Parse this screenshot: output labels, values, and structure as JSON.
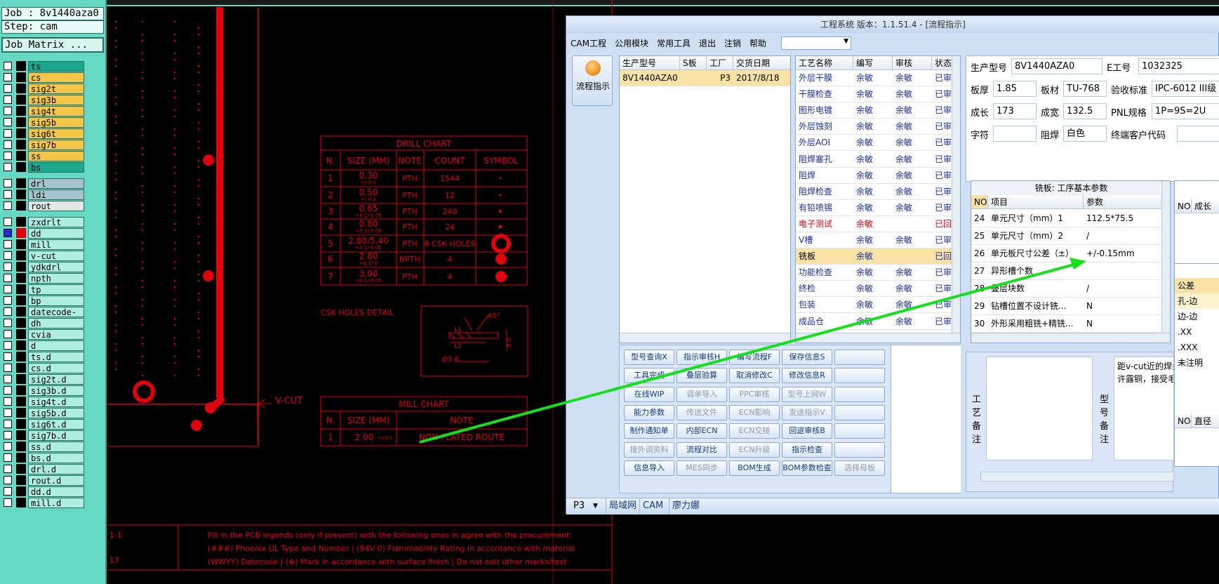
{
  "left_panel": {
    "job": "Job : 8v1440aza0",
    "step": "Step: cam",
    "matrix_button": "Job Matrix ...",
    "groups": [
      [
        {
          "name": "ts",
          "color": "#1aa88c"
        },
        {
          "name": "cs",
          "color": "#f5c648"
        },
        {
          "name": "sig2t",
          "color": "#f5c648"
        },
        {
          "name": "sig3b",
          "color": "#f5c648"
        },
        {
          "name": "sig4t",
          "color": "#f5c648"
        },
        {
          "name": "sig5b",
          "color": "#f5c648"
        },
        {
          "name": "sig6t",
          "color": "#f5c648"
        },
        {
          "name": "sig7b",
          "color": "#f5c648"
        },
        {
          "name": "ss",
          "color": "#f5c648"
        },
        {
          "name": "bs",
          "color": "#1aa88c"
        }
      ],
      [
        {
          "name": "drl",
          "color": "#a7c3cb"
        },
        {
          "name": "ldi",
          "color": "#a7c3cb"
        },
        {
          "name": "rout",
          "color": "#e3e8e2"
        }
      ],
      [
        {
          "name": "zxdrlt",
          "color": "#aeeee0"
        },
        {
          "name": "dd",
          "color": "#aeeee0",
          "active": true
        },
        {
          "name": "mill",
          "color": "#aeeee0"
        },
        {
          "name": "v-cut",
          "color": "#aeeee0"
        },
        {
          "name": "ydkdrl",
          "color": "#aeeee0"
        },
        {
          "name": "npth",
          "color": "#aeeee0"
        },
        {
          "name": "tp",
          "color": "#aeeee0"
        },
        {
          "name": "bp",
          "color": "#aeeee0"
        },
        {
          "name": "datecode-bs",
          "color": "#aeeee0"
        },
        {
          "name": "dh",
          "color": "#aeeee0"
        },
        {
          "name": "cvia",
          "color": "#aeeee0"
        },
        {
          "name": "d",
          "color": "#aeeee0"
        },
        {
          "name": "ts.d",
          "color": "#aeeee0"
        },
        {
          "name": "cs.d",
          "color": "#aeeee0"
        },
        {
          "name": "sig2t.d",
          "color": "#aeeee0"
        },
        {
          "name": "sig3b.d",
          "color": "#aeeee0"
        },
        {
          "name": "sig4t.d",
          "color": "#aeeee0"
        },
        {
          "name": "sig5b.d",
          "color": "#aeeee0"
        },
        {
          "name": "sig6t.d",
          "color": "#aeeee0"
        },
        {
          "name": "sig7b.d",
          "color": "#aeeee0"
        },
        {
          "name": "ss.d",
          "color": "#aeeee0"
        },
        {
          "name": "bs.d",
          "color": "#aeeee0"
        },
        {
          "name": "drl.d",
          "color": "#aeeee0"
        },
        {
          "name": "rout.d",
          "color": "#aeeee0"
        },
        {
          "name": "dd.d",
          "color": "#aeeee0"
        },
        {
          "name": "mill.d",
          "color": "#aeeee0"
        }
      ]
    ]
  },
  "cad": {
    "drill_title": "DRILL CHART",
    "drill_headers": [
      "N.",
      "SIZE (MM)",
      "NOTE",
      "COUNT",
      "SYMBOL"
    ],
    "drill_rows": [
      {
        "n": "1",
        "size": "0.30",
        "tol": "+/-0.1",
        "note": "PTH",
        "count": "1544"
      },
      {
        "n": "2",
        "size": "0.50",
        "tol": "+/-0.1",
        "note": "PTH",
        "count": "12"
      },
      {
        "n": "3",
        "size": "0.65",
        "tol": "+0.1/-0.05",
        "note": "PTH",
        "count": "240"
      },
      {
        "n": "4",
        "size": "0.80",
        "tol": "+0.1/-0.05",
        "note": "PTH",
        "count": "24"
      },
      {
        "n": "5",
        "size": "2.80/5.40",
        "tol": "+0.1/-0.05",
        "note": "PTH",
        "count": "8 CSK HOLES"
      },
      {
        "n": "6",
        "size": "2.80",
        "tol": "+0.1/-0",
        "note": "NPTH",
        "count": "4"
      },
      {
        "n": "7",
        "size": "3.00",
        "tol": "+0.1/-0.05",
        "note": "PTH",
        "count": "4"
      }
    ],
    "csk_label": "CSK HOLES DETAIL",
    "csk_angle": "45°",
    "csk_dim1": "L1",
    "csk_dim2": "L2",
    "csk_diam": "Ø3.8",
    "csk_side": "0.5",
    "vcut_label": "V-CUT",
    "mill_title": "MILL CHART",
    "mill_headers": [
      "N.",
      "SIZE (MM)",
      "NOTE"
    ],
    "mill_row": {
      "n": "1",
      "size": "2.00",
      "tol": "+/-0.1",
      "note": "NON PLATED ROUTE"
    },
    "bottom_left_1": "1-1",
    "bottom_left_2": "17",
    "note_lines": [
      "Fill in the PCB legends (only if present) with the following ones in agree with the procurement:",
      "(###) Phoenix UL Type and Number | (94V-0) Flammability Rating in accordance with material",
      "(WWYY) Datecode | (⊕) Mark in accordance with surface finish | Do not edit other marks/text"
    ]
  },
  "window": {
    "title": "工程系统  版本：1.1.51.4 - [流程指示]",
    "menu": [
      "CAM工程",
      "公用模块",
      "常用工具",
      "退出",
      "注销",
      "帮助"
    ],
    "side_button": "流程指示",
    "job_grid": {
      "headers": [
        "生产型号",
        "S板",
        "工厂",
        "交货日期"
      ],
      "rows": [
        [
          "8V1440AZA0",
          "",
          "P3",
          "2017/8/18"
        ]
      ]
    },
    "process_grid": {
      "headers": [
        "工艺名称",
        "编写",
        "审核",
        "状态"
      ],
      "rows": [
        {
          "name": "外层干膜",
          "writer": "余敏",
          "checker": "余敏",
          "status": "已审"
        },
        {
          "name": "干膜检查",
          "writer": "余敏",
          "checker": "余敏",
          "status": "已审"
        },
        {
          "name": "图形电镀",
          "writer": "余敏",
          "checker": "余敏",
          "status": "已审"
        },
        {
          "name": "外层蚀刻",
          "writer": "余敏",
          "checker": "余敏",
          "status": "已审"
        },
        {
          "name": "外层AOI",
          "writer": "余敏",
          "checker": "余敏",
          "status": "已审"
        },
        {
          "name": "阻焊塞孔",
          "writer": "余敏",
          "checker": "余敏",
          "status": "已审"
        },
        {
          "name": "阻焊",
          "writer": "余敏",
          "checker": "余敏",
          "status": "已审"
        },
        {
          "name": "阻焊检查",
          "writer": "余敏",
          "checker": "余敏",
          "status": "已审"
        },
        {
          "name": "有铅喷锡",
          "writer": "余敏",
          "checker": "余敏",
          "status": "已审"
        },
        {
          "name": "电子测试",
          "writer": "余敏",
          "checker": "",
          "status": "已回",
          "red": true
        },
        {
          "name": "V槽",
          "writer": "余敏",
          "checker": "余敏",
          "status": "已审"
        },
        {
          "name": "铣板",
          "writer": "余敏",
          "checker": "",
          "status": "已回",
          "selected": true
        },
        {
          "name": "功能检查",
          "writer": "余敏",
          "checker": "余敏",
          "status": "已审"
        },
        {
          "name": "终检",
          "writer": "余敏",
          "checker": "余敏",
          "status": "已审"
        },
        {
          "name": "包装",
          "writer": "余敏",
          "checker": "余敏",
          "status": "已审"
        },
        {
          "name": "成品仓",
          "writer": "余敏",
          "checker": "余敏",
          "status": "已审"
        }
      ]
    },
    "buttons": [
      [
        "型号查询X",
        "指示审核H",
        "编写流程F",
        "保存信息S",
        ""
      ],
      [
        "工具完成",
        "叠层验算",
        "取消修改C",
        "修改信息R",
        ""
      ],
      [
        "在线WIP",
        "调单导入",
        "PPC审核",
        "型号上网W",
        ""
      ],
      [
        "能力参数",
        "传送文件",
        "ECN影响",
        "发送指示V",
        ""
      ],
      [
        "制作通知单",
        "内部ECN",
        "ECN交接",
        "回退审核B",
        ""
      ],
      [
        "接外调资料",
        "流程对比",
        "ECN升级",
        "指示检查",
        ""
      ],
      [
        "信息导入",
        "MES同步",
        "BOM生成",
        "BOM参数检查",
        "选择母板"
      ]
    ],
    "disabled_buttons": [
      "调单导入",
      "PPC审核",
      "型号上网W",
      "传送文件",
      "ECN影响",
      "发送指示V",
      "ECN交接",
      "接外调资料",
      "ECN升级",
      "MES同步",
      "选择母板"
    ],
    "info": {
      "model_label": "生产型号",
      "model": "8V1440AZA0",
      "eno_label": "E工号",
      "eno": "1032325",
      "thick_label": "板厚",
      "thick": "1.85",
      "mat_label": "板材",
      "mat": "TU-768",
      "std_label": "验收标准",
      "std": "IPC-6012 III级",
      "len_label": "成长",
      "len": "173",
      "fin_label": "成宽",
      "fin": "132.5",
      "pnl_label": "PNL规格",
      "pnl": "1P=9S=2U",
      "char_label": "字符",
      "char": "",
      "mask_label": "阻焊",
      "mask": "白色",
      "cust_label": "终端客户代码",
      "cust": ""
    },
    "params": {
      "title": "铣板: 工序基本参数",
      "headers": [
        "NO",
        "项目",
        "参数"
      ],
      "rows": [
        [
          "24",
          "单元尺寸（mm）1",
          "112.5*75.5"
        ],
        [
          "25",
          "单元尺寸（mm）2",
          "/"
        ],
        [
          "26",
          "单元板尺寸公差（±）",
          "+/-0.15mm"
        ],
        [
          "27",
          "异形槽个数",
          ""
        ],
        [
          "28",
          "叠层块数",
          "/"
        ],
        [
          "29",
          "钻槽位置不设计铣...",
          "N"
        ],
        [
          "30",
          "外形采用粗铣+精铣...",
          "N"
        ]
      ]
    },
    "right_grid": {
      "headers": [
        "NO",
        "成长"
      ],
      "tol_head": "公差",
      "tol_rows": [
        "孔-边",
        "边-边",
        ".XX",
        ".XXX",
        "未注明"
      ],
      "headers2": [
        "NO",
        "直径"
      ]
    },
    "remarks": {
      "process": "工艺备注",
      "model": "型号备注",
      "text_line1": "距v-cut近的焊盘",
      "text_line2": "许露铜，接受毛"
    },
    "status_bar": {
      "site": "P3",
      "tabs": [
        "局域网",
        "CAM",
        "廖力娜"
      ]
    }
  }
}
